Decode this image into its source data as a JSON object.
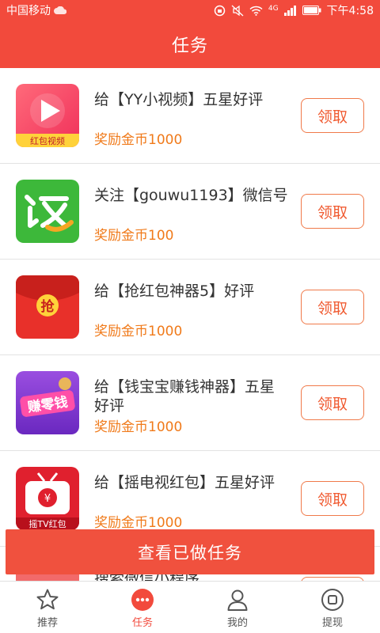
{
  "status_bar": {
    "carrier": "中国移动",
    "network": "4G",
    "time": "下午4:58"
  },
  "header": {
    "title": "任务"
  },
  "tasks": [
    {
      "icon": "video-app-icon",
      "icon_caption": "红包视频",
      "title": "给【YY小视频】五星好评",
      "reward": "奖励金币1000",
      "action": "领取"
    },
    {
      "icon": "rebate-app-icon",
      "title": "关注【gouwu1193】微信号",
      "reward": "奖励金币100",
      "action": "领取"
    },
    {
      "icon": "red-envelope-app-icon",
      "icon_caption": "抢",
      "title": "给【抢红包神器5】好评",
      "reward": "奖励金币1000",
      "action": "领取"
    },
    {
      "icon": "money-app-icon",
      "icon_caption": "赚零钱",
      "title": "给【钱宝宝赚钱神器】五星好评",
      "reward": "奖励金币1000",
      "action": "领取"
    },
    {
      "icon": "tv-red-envelope-app-icon",
      "icon_caption": "摇TV红包",
      "title": "给【摇电视红包】五星好评",
      "reward": "奖励金币1000",
      "action": "领取"
    },
    {
      "title": "搜索微信小程序",
      "reward": "",
      "action": "领取"
    }
  ],
  "view_done_button": "查看已做任务",
  "tab_bar": [
    {
      "label": "推荐",
      "icon": "star-icon",
      "active": false
    },
    {
      "label": "任务",
      "icon": "more-dots-icon",
      "active": true
    },
    {
      "label": "我的",
      "icon": "person-icon",
      "active": false
    },
    {
      "label": "提现",
      "icon": "withdraw-icon",
      "active": false
    }
  ],
  "colors": {
    "primary": "#f24a3c",
    "reward": "#f07a1a",
    "claim_border": "#f07a4a"
  }
}
